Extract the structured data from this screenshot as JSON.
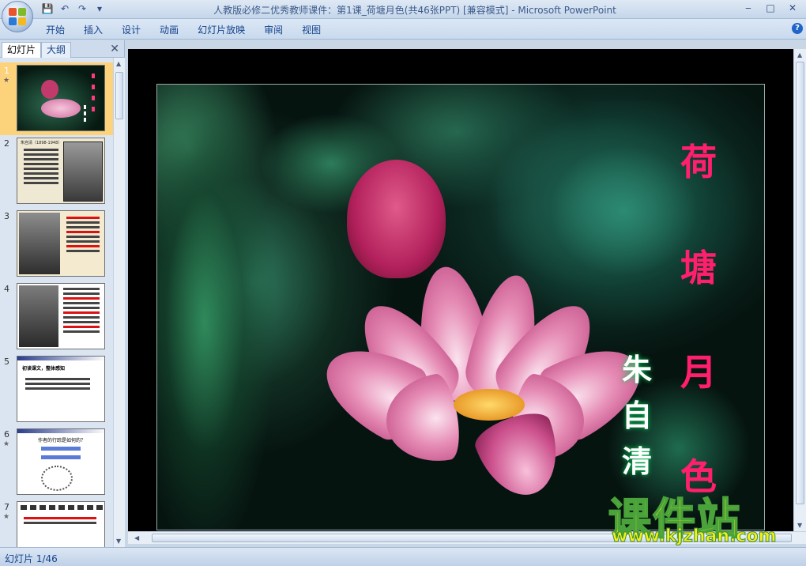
{
  "window": {
    "title": "人教版必修二优秀教师课件：第1课_荷塘月色(共46张PPT) [兼容模式] - Microsoft PowerPoint"
  },
  "ribbon": {
    "tabs": [
      "开始",
      "插入",
      "设计",
      "动画",
      "幻灯片放映",
      "审阅",
      "视图"
    ]
  },
  "panel": {
    "tab_slides": "幻灯片",
    "tab_outline": "大纲",
    "thumbnails": [
      {
        "num": "1",
        "selected": true
      },
      {
        "num": "2",
        "selected": false
      },
      {
        "num": "3",
        "selected": false
      },
      {
        "num": "4",
        "selected": false
      },
      {
        "num": "5",
        "selected": false
      },
      {
        "num": "6",
        "selected": false
      },
      {
        "num": "7",
        "selected": false
      }
    ],
    "slide2_heading": "朱自清（1898-1948）",
    "slide5_heading": "初读课文，整体感知",
    "slide6_heading": "作者的行踪是如何的？"
  },
  "slide": {
    "title_chars": [
      "荷",
      "塘",
      "月",
      "色"
    ],
    "author_chars": [
      "朱",
      "自",
      "清"
    ]
  },
  "status": {
    "slide_counter": "幻灯片 1/46"
  },
  "watermark": {
    "main": "课件站",
    "url": "www.kjzhan.com"
  },
  "colors": {
    "title_pink": "#ff1f6d",
    "selected_thumb": "#fcd27a",
    "ribbon_text": "#15428b"
  }
}
